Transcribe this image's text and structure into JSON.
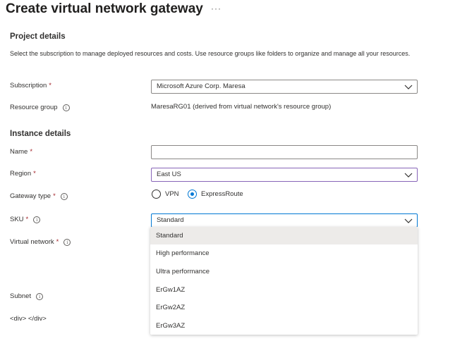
{
  "header": {
    "title": "Create virtual network gateway",
    "more_label": "···"
  },
  "project_details": {
    "heading": "Project details",
    "description": "Select the subscription to manage deployed resources and costs. Use resource groups like folders to organize and manage all your resources.",
    "subscription": {
      "label": "Subscription",
      "required_mark": "*",
      "value": "Microsoft Azure Corp. Maresa"
    },
    "resource_group": {
      "label": "Resource group",
      "value": "MaresaRG01 (derived from virtual network's resource group)"
    }
  },
  "instance_details": {
    "heading": "Instance details",
    "name": {
      "label": "Name",
      "required_mark": "*",
      "value": ""
    },
    "region": {
      "label": "Region",
      "required_mark": "*",
      "value": "East US"
    },
    "gateway_type": {
      "label": "Gateway type",
      "required_mark": "*",
      "options": [
        "VPN",
        "ExpressRoute"
      ],
      "selected": "ExpressRoute"
    },
    "sku": {
      "label": "SKU",
      "required_mark": "*",
      "value": "Standard",
      "options": [
        "Standard",
        "High performance",
        "Ultra performance",
        "ErGw1AZ",
        "ErGw2AZ",
        "ErGw3AZ"
      ],
      "highlighted": "Standard"
    },
    "virtual_network": {
      "label": "Virtual network",
      "required_mark": "*"
    },
    "subnet": {
      "label": "Subnet"
    },
    "raw_markup_text": "<div> </div>"
  },
  "icons": {
    "info": "info-icon",
    "chevron": "chevron-down-icon",
    "more": "more-icon"
  },
  "colors": {
    "required": "#a4262c",
    "accent": "#0078d4",
    "region_border": "#8764b8",
    "selected_option_bg": "#edebe9"
  }
}
